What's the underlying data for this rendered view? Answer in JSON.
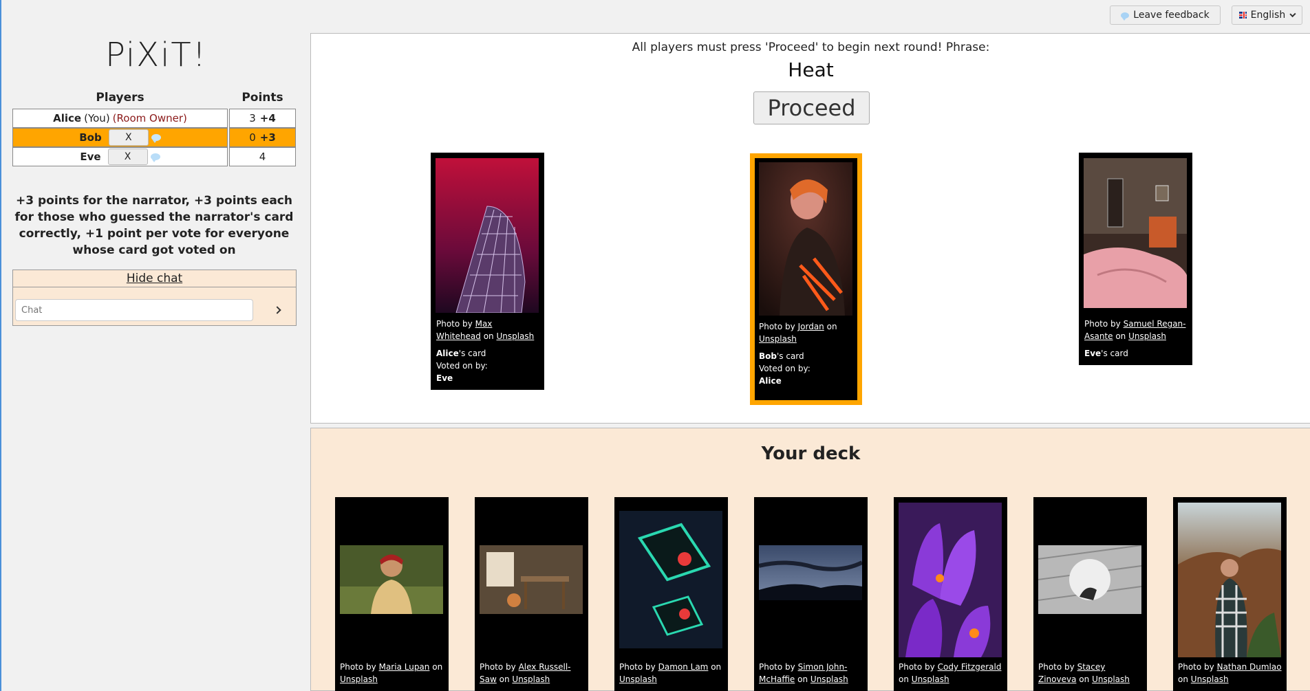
{
  "topbar": {
    "feedback_label": "Leave feedback",
    "language_label": "English"
  },
  "logo": "PiXiT!",
  "players_table": {
    "col_players": "Players",
    "col_points": "Points",
    "rows": [
      {
        "name": "Alice",
        "you": "(You)",
        "owner": "(Room Owner)",
        "points": "3",
        "delta": "+4"
      },
      {
        "name": "Bob",
        "kick": "X",
        "points": "0",
        "delta": "+3"
      },
      {
        "name": "Eve",
        "kick": "X",
        "points": "4",
        "delta": ""
      }
    ]
  },
  "rules_text": "+3 points for the narrator, +3 points each for those who guessed the narrator's card correctly, +1 point per vote for everyone whose card got voted on",
  "chat": {
    "toggle_label": "Hide chat",
    "placeholder": "Chat"
  },
  "board": {
    "status": "All players must press 'Proceed' to begin next round! Phrase:",
    "phrase": "Heat",
    "proceed_label": "Proceed",
    "cards": [
      {
        "photo_by": "Photo by",
        "author": "Max Whitehead",
        "on": "on",
        "source": "Unsplash",
        "owner": "Alice",
        "owner_suffix": "'s card",
        "voted_label": "Voted on by:",
        "voters": "Eve"
      },
      {
        "photo_by": "Photo by",
        "author": "Jordan",
        "on": "on",
        "source": "Unsplash",
        "owner": "Bob",
        "owner_suffix": "'s card",
        "voted_label": "Voted on by:",
        "voters": "Alice"
      },
      {
        "photo_by": "Photo by",
        "author": "Samuel Regan-Asante",
        "on": "on",
        "source": "Unsplash",
        "owner": "Eve",
        "owner_suffix": "'s card"
      }
    ]
  },
  "deck": {
    "title": "Your deck",
    "cards": [
      {
        "photo_by": "Photo by",
        "author": "Maria Lupan",
        "on": "on",
        "source": "Unsplash"
      },
      {
        "photo_by": "Photo by",
        "author": "Alex Russell-Saw",
        "on": "on",
        "source": "Unsplash"
      },
      {
        "photo_by": "Photo by",
        "author": "Damon Lam",
        "on": "on",
        "source": "Unsplash"
      },
      {
        "photo_by": "Photo by",
        "author": "Simon John-McHaffie",
        "on": "on",
        "source": "Unsplash"
      },
      {
        "photo_by": "Photo by",
        "author": "Cody Fitzgerald",
        "on": "on",
        "source": "Unsplash"
      },
      {
        "photo_by": "Photo by",
        "author": "Stacey Zinoveva",
        "on": "on",
        "source": "Unsplash"
      },
      {
        "photo_by": "Photo by",
        "author": "Nathan Dumlao",
        "on": "on",
        "source": "Unsplash"
      }
    ]
  },
  "colors": {
    "accent": "#ffa500",
    "deck_bg": "#fbe9d6",
    "owner_text": "#8b1a1a"
  }
}
